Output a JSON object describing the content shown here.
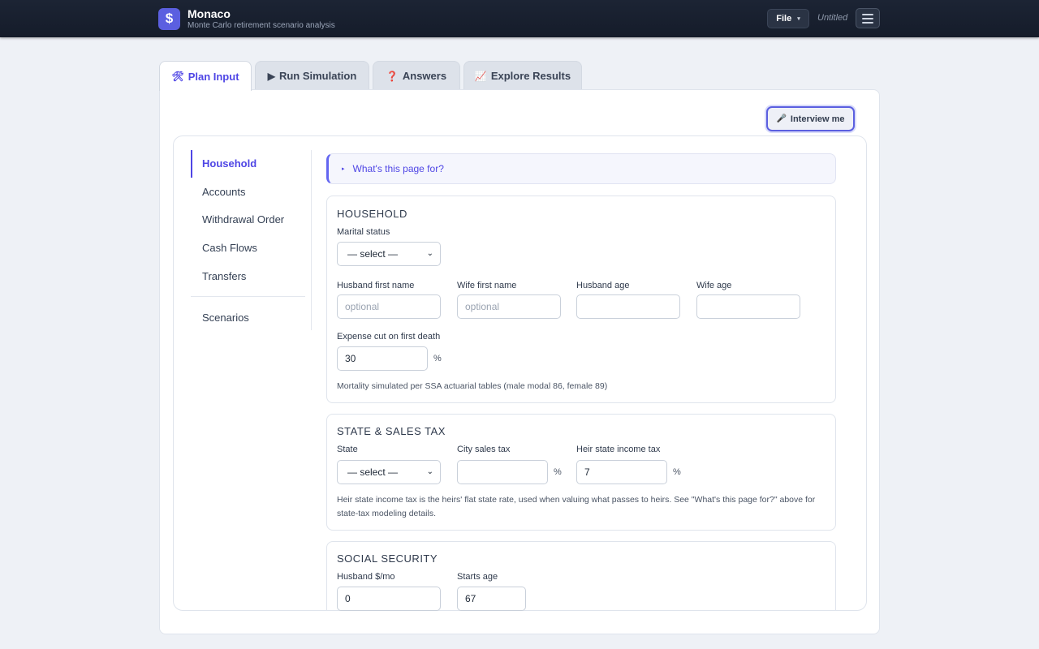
{
  "header": {
    "logo_glyph": "$",
    "app_name": "Monaco",
    "subtitle": "Monte Carlo retirement scenario analysis",
    "file_label": "File",
    "file_caret": "▾",
    "doc_name": "Untitled"
  },
  "tabs": [
    {
      "icon": "🛠",
      "label": "Plan Input"
    },
    {
      "icon": "▶",
      "label": "Run Simulation"
    },
    {
      "icon": "❓",
      "label": "Answers"
    },
    {
      "icon": "📈",
      "label": "Explore Results"
    }
  ],
  "interview": {
    "icon": "🎤",
    "label": "Interview me"
  },
  "sidenav": {
    "items": [
      "Household",
      "Accounts",
      "Withdrawal Order",
      "Cash Flows",
      "Transfers"
    ],
    "extra": "Scenarios"
  },
  "help": {
    "tri": "▸",
    "label": "What's this page for?"
  },
  "household": {
    "title": "HOUSEHOLD",
    "marital_label": "Marital status",
    "marital_value": "— select —",
    "husband_name_label": "Husband first name",
    "husband_name_placeholder": "optional",
    "wife_name_label": "Wife first name",
    "wife_name_placeholder": "optional",
    "husband_age_label": "Husband age",
    "husband_age_value": "",
    "wife_age_label": "Wife age",
    "wife_age_value": "",
    "expense_cut_label": "Expense cut on first death",
    "expense_cut_value": "30",
    "expense_cut_unit": "%",
    "mortality_note": "Mortality simulated per SSA actuarial tables (male modal 86, female 89)"
  },
  "state_tax": {
    "title": "STATE & SALES TAX",
    "state_label": "State",
    "state_value": "— select —",
    "city_tax_label": "City sales tax",
    "city_tax_value": "",
    "city_tax_unit": "%",
    "heir_tax_label": "Heir state income tax",
    "heir_tax_value": "7",
    "heir_tax_unit": "%",
    "note_line1": "Heir state income tax is the heirs' flat state rate, used when valuing what passes to heirs. See \"What's this page for?\" above for",
    "note_line2": "state-tax modeling details."
  },
  "social_security": {
    "title": "SOCIAL SECURITY",
    "husband_label": "Husband $/mo",
    "husband_value": "0",
    "starts_age_label": "Starts age",
    "starts_age_value": "67"
  },
  "colors": {
    "accent": "#4f46e5",
    "header_bg": "#1a2232",
    "logo": "#5b5fe0"
  }
}
